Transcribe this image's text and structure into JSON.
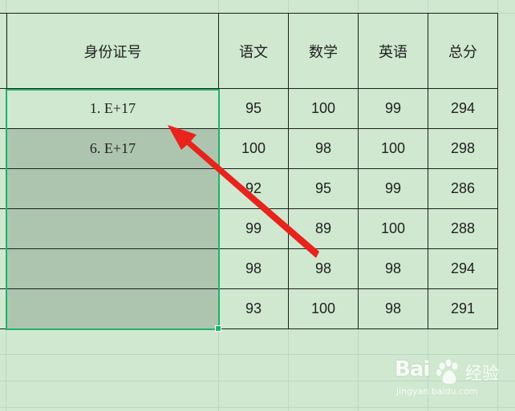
{
  "headers": {
    "id": "身份证号",
    "chinese": "语文",
    "math": "数学",
    "english": "英语",
    "total": "总分"
  },
  "rows": [
    {
      "id": "1. E+17",
      "chinese": "95",
      "math": "100",
      "english": "99",
      "total": "294"
    },
    {
      "id": "6. E+17",
      "chinese": "100",
      "math": "98",
      "english": "100",
      "total": "298"
    },
    {
      "id": "",
      "chinese": "92",
      "math": "95",
      "english": "99",
      "total": "286"
    },
    {
      "id": "",
      "chinese": "99",
      "math": "89",
      "english": "100",
      "total": "288"
    },
    {
      "id": "",
      "chinese": "98",
      "math": "98",
      "english": "98",
      "total": "294"
    },
    {
      "id": "",
      "chinese": "93",
      "math": "100",
      "english": "98",
      "total": "291"
    }
  ],
  "watermark": {
    "brand": "Bai",
    "brand_suffix": "经验",
    "url": "jingyan.baidu.com"
  },
  "colors": {
    "background": "#cfe8cf",
    "selection_border": "#1fb36b",
    "selection_fill": "#adc5af",
    "arrow": "#e8231c"
  },
  "icons": {
    "arrow": "red-arrow-icon",
    "watermark_paw": "baidu-paw-icon"
  }
}
